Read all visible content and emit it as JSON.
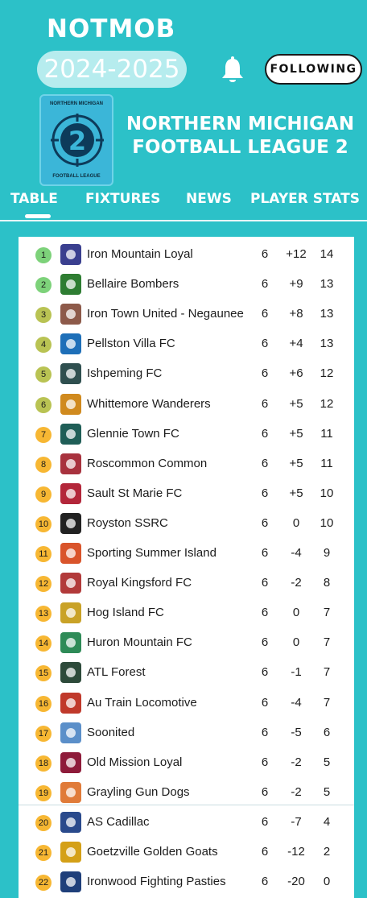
{
  "app": {
    "title": "NOTMOB",
    "season": "2024-2025",
    "follow_label": "FOLLOWING",
    "bell_icon": "bell-icon"
  },
  "league": {
    "name_line1": "NORTHERN MICHIGAN",
    "name_line2": "FOOTBALL LEAGUE 2",
    "logo_top": "NORTHERN MICHIGAN",
    "logo_number": "2",
    "logo_bottom": "FOOTBALL LEAGUE"
  },
  "tabs": [
    {
      "label": "TABLE",
      "active": true
    },
    {
      "label": "FIXTURES",
      "active": false
    },
    {
      "label": "NEWS",
      "active": false
    },
    {
      "label": "PLAYER STATS",
      "active": false
    }
  ],
  "colors": {
    "background": "#2cc1c8",
    "pos_green": "#7dd27a",
    "pos_olive": "#b9c353",
    "pos_orange": "#f7b733"
  },
  "standings": [
    {
      "pos": "1",
      "team": "Iron Mountain Loyal",
      "played": "6",
      "gd": "+12",
      "pts": "14",
      "crest": "#3a3f8f"
    },
    {
      "pos": "2",
      "team": "Bellaire Bombers",
      "played": "6",
      "gd": "+9",
      "pts": "13",
      "crest": "#2e7d32"
    },
    {
      "pos": "3",
      "team": "Iron Town United - Negaunee",
      "played": "6",
      "gd": "+8",
      "pts": "13",
      "crest": "#8d5a4a"
    },
    {
      "pos": "4",
      "team": "Pellston Villa FC",
      "played": "6",
      "gd": "+4",
      "pts": "13",
      "crest": "#1e6fb8"
    },
    {
      "pos": "5",
      "team": "Ishpeming FC",
      "played": "6",
      "gd": "+6",
      "pts": "12",
      "crest": "#2f4f4f"
    },
    {
      "pos": "6",
      "team": "Whittemore Wanderers",
      "played": "6",
      "gd": "+5",
      "pts": "12",
      "crest": "#d08a1e"
    },
    {
      "pos": "7",
      "team": "Glennie Town FC",
      "played": "6",
      "gd": "+5",
      "pts": "11",
      "crest": "#1f5e57"
    },
    {
      "pos": "8",
      "team": "Roscommon Common",
      "played": "6",
      "gd": "+5",
      "pts": "11",
      "crest": "#a8323e"
    },
    {
      "pos": "9",
      "team": "Sault St Marie FC",
      "played": "6",
      "gd": "+5",
      "pts": "10",
      "crest": "#b3263a"
    },
    {
      "pos": "10",
      "team": "Royston SSRC",
      "played": "6",
      "gd": "0",
      "pts": "10",
      "crest": "#222222"
    },
    {
      "pos": "11",
      "team": "Sporting Summer Island",
      "played": "6",
      "gd": "-4",
      "pts": "9",
      "crest": "#d9542b"
    },
    {
      "pos": "12",
      "team": "Royal Kingsford FC",
      "played": "6",
      "gd": "-2",
      "pts": "8",
      "crest": "#b23a3a"
    },
    {
      "pos": "13",
      "team": "Hog Island FC",
      "played": "6",
      "gd": "0",
      "pts": "7",
      "crest": "#c9a227"
    },
    {
      "pos": "14",
      "team": "Huron Mountain FC",
      "played": "6",
      "gd": "0",
      "pts": "7",
      "crest": "#2e8b57"
    },
    {
      "pos": "15",
      "team": "ATL Forest",
      "played": "6",
      "gd": "-1",
      "pts": "7",
      "crest": "#2d4a3a"
    },
    {
      "pos": "16",
      "team": "Au Train Locomotive",
      "played": "6",
      "gd": "-4",
      "pts": "7",
      "crest": "#c0392b"
    },
    {
      "pos": "17",
      "team": "Soonited",
      "played": "6",
      "gd": "-5",
      "pts": "6",
      "crest": "#5b8fc9"
    },
    {
      "pos": "18",
      "team": "Old Mission Loyal",
      "played": "6",
      "gd": "-2",
      "pts": "5",
      "crest": "#8e1b3a"
    },
    {
      "pos": "19",
      "team": "Grayling Gun Dogs",
      "played": "6",
      "gd": "-2",
      "pts": "5",
      "crest": "#e07b39"
    },
    {
      "pos": "20",
      "team": "AS Cadillac",
      "played": "6",
      "gd": "-7",
      "pts": "4",
      "crest": "#2a4a8c"
    },
    {
      "pos": "21",
      "team": "Goetzville Golden Goats",
      "played": "6",
      "gd": "-12",
      "pts": "2",
      "crest": "#d4a017"
    },
    {
      "pos": "22",
      "team": "Ironwood Fighting Pasties",
      "played": "6",
      "gd": "-20",
      "pts": "0",
      "crest": "#1f3f7a"
    }
  ]
}
